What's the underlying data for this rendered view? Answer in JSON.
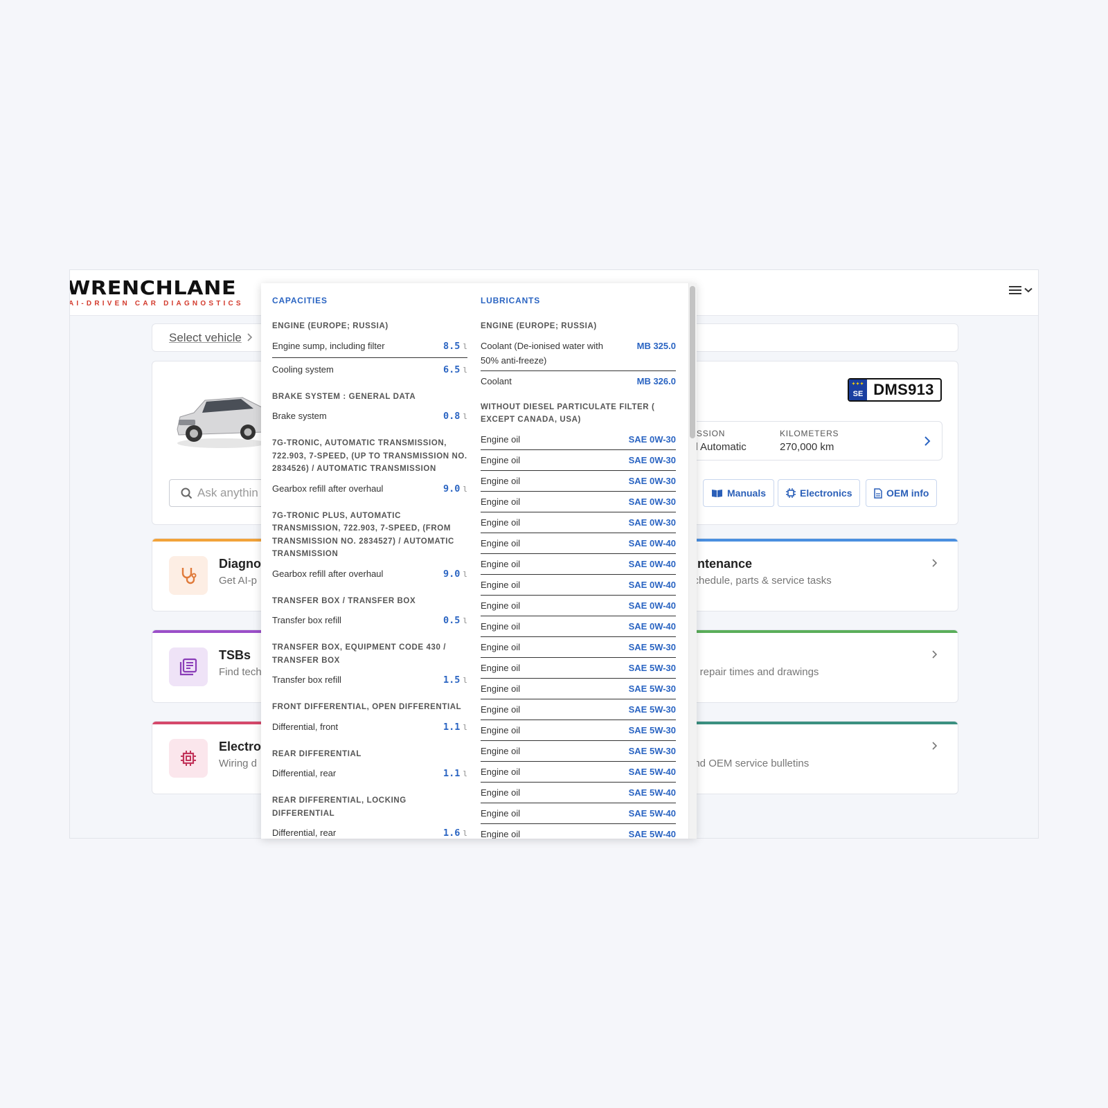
{
  "brand": {
    "name": "WRENCHLANE",
    "tagline": "AI-DRIVEN CAR DIAGNOSTICS"
  },
  "breadcrumb": {
    "select_vehicle": "Select vehicle"
  },
  "vehicle": {
    "plate_country": "SE",
    "plate": "DMS913",
    "specs": [
      {
        "label": "MISSION",
        "value": "ed Automatic"
      },
      {
        "label": "KILOMETERS",
        "value": "270,000 km"
      }
    ]
  },
  "search": {
    "placeholder": "Ask anythin"
  },
  "chips": {
    "manuals": "Manuals",
    "electronics": "Electronics",
    "oem": "OEM info"
  },
  "categories": [
    {
      "title": "Diagno",
      "subtitle": "Get AI-p",
      "right_title": "aintenance",
      "right_subtitle": "schedule, parts & service tasks",
      "color": "#f2a33a",
      "right_color": "#4a8fe0",
      "icon_bg": "#fdeee4",
      "icon_color": "#e07a3a"
    },
    {
      "title": "TSBs",
      "subtitle": "Find tech",
      "right_title": "",
      "right_subtitle": "a, repair times and drawings",
      "color": "#9b4fc9",
      "right_color": "#5aae5a",
      "icon_bg": "#efe3f7",
      "icon_color": "#8a3db8"
    },
    {
      "title": "Electro",
      "subtitle": "Wiring d",
      "right_title": "",
      "right_subtitle": "and OEM service bulletins",
      "color": "#d5486a",
      "right_color": "#3a9080",
      "icon_bg": "#fbe6ec",
      "icon_color": "#c2335a"
    }
  ],
  "popup": {
    "capacities": {
      "title": "CAPACITIES",
      "groups": [
        {
          "name": "ENGINE (EUROPE; RUSSIA)",
          "rows": [
            {
              "label": "Engine sump, including filter",
              "value": "8.5",
              "unit": "l"
            },
            {
              "label": "Cooling system",
              "value": "6.5",
              "unit": "l"
            }
          ]
        },
        {
          "name": "BRAKE SYSTEM : GENERAL DATA",
          "rows": [
            {
              "label": "Brake system",
              "value": "0.8",
              "unit": "l"
            }
          ]
        },
        {
          "name": "7G-TRONIC, AUTOMATIC TRANSMISSION, 722.903, 7-SPEED, (UP TO TRANSMISSION NO. 2834526) / AUTOMATIC TRANSMISSION",
          "rows": [
            {
              "label": "Gearbox refill after overhaul",
              "value": "9.0",
              "unit": "l"
            }
          ]
        },
        {
          "name": "7G-TRONIC PLUS, AUTOMATIC TRANSMISSION, 722.903, 7-SPEED, (FROM TRANSMISSION NO. 2834527) / AUTOMATIC TRANSMISSION",
          "rows": [
            {
              "label": "Gearbox refill after overhaul",
              "value": "9.0",
              "unit": "l"
            }
          ]
        },
        {
          "name": "TRANSFER BOX / TRANSFER BOX",
          "rows": [
            {
              "label": "Transfer box refill",
              "value": "0.5",
              "unit": "l"
            }
          ]
        },
        {
          "name": "TRANSFER BOX, EQUIPMENT CODE 430 / TRANSFER BOX",
          "rows": [
            {
              "label": "Transfer box refill",
              "value": "1.5",
              "unit": "l"
            }
          ]
        },
        {
          "name": "FRONT DIFFERENTIAL, OPEN DIFFERENTIAL",
          "rows": [
            {
              "label": "Differential, front",
              "value": "1.1",
              "unit": "l"
            }
          ]
        },
        {
          "name": "REAR DIFFERENTIAL",
          "rows": [
            {
              "label": "Differential, rear",
              "value": "1.1",
              "unit": "l"
            }
          ]
        },
        {
          "name": "REAR DIFFERENTIAL, LOCKING DIFFERENTIAL",
          "rows": [
            {
              "label": "Differential, rear",
              "value": "1.6",
              "unit": "l"
            }
          ]
        }
      ]
    },
    "lubricants": {
      "title": "LUBRICANTS",
      "groups": [
        {
          "name": "ENGINE (EUROPE; RUSSIA)",
          "rows": [
            {
              "label": "Coolant (De-ionised water with 50% anti-freeze)",
              "value": "MB 325.0"
            },
            {
              "label": "Coolant",
              "value": "MB 326.0"
            }
          ]
        },
        {
          "name": "WITHOUT DIESEL PARTICULATE FILTER ( EXCEPT CANADA, USA)",
          "rows": [
            {
              "label": "Engine oil",
              "value": "SAE 0W-30"
            },
            {
              "label": "Engine oil",
              "value": "SAE 0W-30"
            },
            {
              "label": "Engine oil",
              "value": "SAE 0W-30"
            },
            {
              "label": "Engine oil",
              "value": "SAE 0W-30"
            },
            {
              "label": "Engine oil",
              "value": "SAE 0W-30"
            },
            {
              "label": "Engine oil",
              "value": "SAE 0W-40"
            },
            {
              "label": "Engine oil",
              "value": "SAE 0W-40"
            },
            {
              "label": "Engine oil",
              "value": "SAE 0W-40"
            },
            {
              "label": "Engine oil",
              "value": "SAE 0W-40"
            },
            {
              "label": "Engine oil",
              "value": "SAE 0W-40"
            },
            {
              "label": "Engine oil",
              "value": "SAE 5W-30"
            },
            {
              "label": "Engine oil",
              "value": "SAE 5W-30"
            },
            {
              "label": "Engine oil",
              "value": "SAE 5W-30"
            },
            {
              "label": "Engine oil",
              "value": "SAE 5W-30"
            },
            {
              "label": "Engine oil",
              "value": "SAE 5W-30"
            },
            {
              "label": "Engine oil",
              "value": "SAE 5W-30"
            },
            {
              "label": "Engine oil",
              "value": "SAE 5W-40"
            },
            {
              "label": "Engine oil",
              "value": "SAE 5W-40"
            },
            {
              "label": "Engine oil",
              "value": "SAE 5W-40"
            },
            {
              "label": "Engine oil",
              "value": "SAE 5W-40"
            }
          ]
        }
      ]
    }
  }
}
